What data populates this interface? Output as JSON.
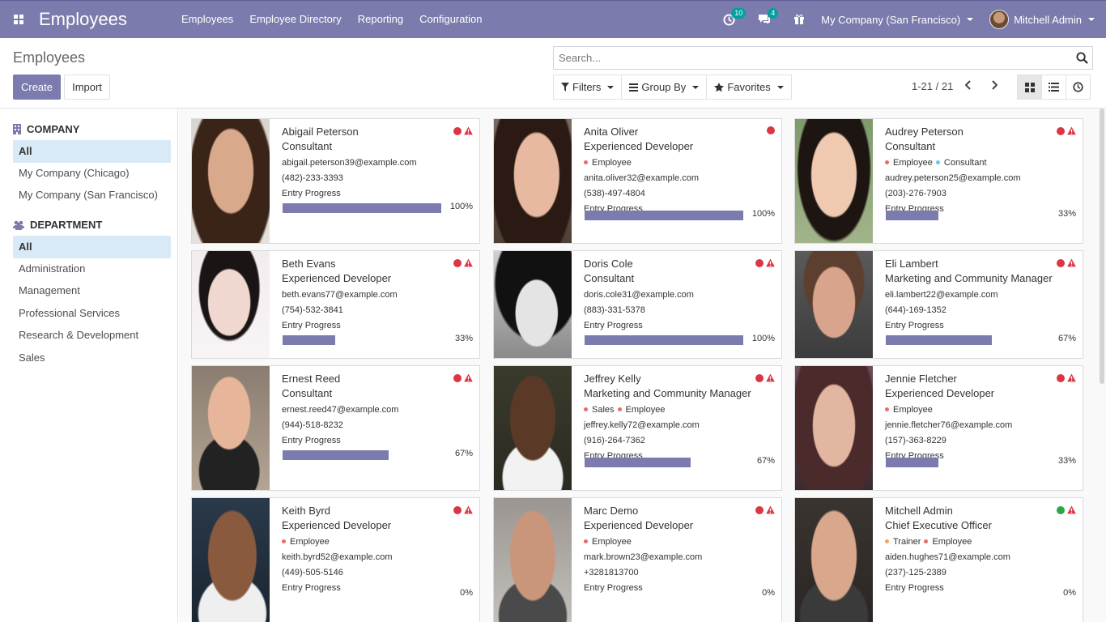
{
  "navbar": {
    "app_title": "Employees",
    "menu": [
      "Employees",
      "Employee Directory",
      "Reporting",
      "Configuration"
    ],
    "activity_count": "10",
    "message_count": "4",
    "company": "My Company (San Francisco)",
    "user": "Mitchell Admin",
    "bg_color": "#7c7bad"
  },
  "control_panel": {
    "breadcrumb": "Employees",
    "create_label": "Create",
    "import_label": "Import",
    "search_placeholder": "Search...",
    "filters_label": "Filters",
    "groupby_label": "Group By",
    "favorites_label": "Favorites",
    "pager": "1-21 / 21"
  },
  "side_panel": {
    "company_header": "COMPANY",
    "companies": [
      "All",
      "My Company (Chicago)",
      "My Company (San Francisco)"
    ],
    "department_header": "DEPARTMENT",
    "departments": [
      "All",
      "Administration",
      "Management",
      "Professional Services",
      "Research & Development",
      "Sales"
    ]
  },
  "progress_label": "Entry Progress",
  "employees": [
    {
      "name": "Abigail Peterson",
      "job": "Consultant",
      "tags": [],
      "email": "abigail.peterson39@example.com",
      "phone": "(482)-233-3393",
      "progress": "100%",
      "progress_value": 100,
      "status": "red",
      "warning": true
    },
    {
      "name": "Anita Oliver",
      "job": "Experienced Developer",
      "tags": [
        {
          "label": "Employee",
          "color": "#e86a6a"
        }
      ],
      "email": "anita.oliver32@example.com",
      "phone": "(538)-497-4804",
      "progress": "100%",
      "progress_value": 100,
      "status": "red",
      "warning": false
    },
    {
      "name": "Audrey Peterson",
      "job": "Consultant",
      "tags": [
        {
          "label": "Employee",
          "color": "#e86a6a"
        },
        {
          "label": "Consultant",
          "color": "#6cc1ed"
        }
      ],
      "email": "audrey.peterson25@example.com",
      "phone": "(203)-276-7903",
      "progress": "33%",
      "progress_value": 33,
      "status": "red",
      "warning": true
    },
    {
      "name": "Beth Evans",
      "job": "Experienced Developer",
      "tags": [],
      "email": "beth.evans77@example.com",
      "phone": "(754)-532-3841",
      "progress": "33%",
      "progress_value": 33,
      "status": "red",
      "warning": true
    },
    {
      "name": "Doris Cole",
      "job": "Consultant",
      "tags": [],
      "email": "doris.cole31@example.com",
      "phone": "(883)-331-5378",
      "progress": "100%",
      "progress_value": 100,
      "status": "red",
      "warning": true
    },
    {
      "name": "Eli Lambert",
      "job": "Marketing and Community Manager",
      "tags": [],
      "email": "eli.lambert22@example.com",
      "phone": "(644)-169-1352",
      "progress": "67%",
      "progress_value": 67,
      "status": "red",
      "warning": true
    },
    {
      "name": "Ernest Reed",
      "job": "Consultant",
      "tags": [],
      "email": "ernest.reed47@example.com",
      "phone": "(944)-518-8232",
      "progress": "67%",
      "progress_value": 67,
      "status": "red",
      "warning": true
    },
    {
      "name": "Jeffrey Kelly",
      "job": "Marketing and Community Manager",
      "tags": [
        {
          "label": "Sales",
          "color": "#e86a6a"
        },
        {
          "label": "Employee",
          "color": "#e86a6a"
        }
      ],
      "email": "jeffrey.kelly72@example.com",
      "phone": "(916)-264-7362",
      "progress": "67%",
      "progress_value": 67,
      "status": "red",
      "warning": true
    },
    {
      "name": "Jennie Fletcher",
      "job": "Experienced Developer",
      "tags": [
        {
          "label": "Employee",
          "color": "#e86a6a"
        }
      ],
      "email": "jennie.fletcher76@example.com",
      "phone": "(157)-363-8229",
      "progress": "33%",
      "progress_value": 33,
      "status": "red",
      "warning": true
    },
    {
      "name": "Keith Byrd",
      "job": "Experienced Developer",
      "tags": [
        {
          "label": "Employee",
          "color": "#e86a6a"
        }
      ],
      "email": "keith.byrd52@example.com",
      "phone": "(449)-505-5146",
      "progress": "0%",
      "progress_value": 0,
      "status": "red",
      "warning": true
    },
    {
      "name": "Marc Demo",
      "job": "Experienced Developer",
      "tags": [
        {
          "label": "Employee",
          "color": "#e86a6a"
        }
      ],
      "email": "mark.brown23@example.com",
      "phone": "+3281813700",
      "progress": "0%",
      "progress_value": 0,
      "status": "red",
      "warning": true
    },
    {
      "name": "Mitchell Admin",
      "job": "Chief Executive Officer",
      "tags": [
        {
          "label": "Trainer",
          "color": "#f4a460"
        },
        {
          "label": "Employee",
          "color": "#e86a6a"
        }
      ],
      "email": "aiden.hughes71@example.com",
      "phone": "(237)-125-2389",
      "progress": "0%",
      "progress_value": 0,
      "status": "green",
      "warning": true
    }
  ]
}
